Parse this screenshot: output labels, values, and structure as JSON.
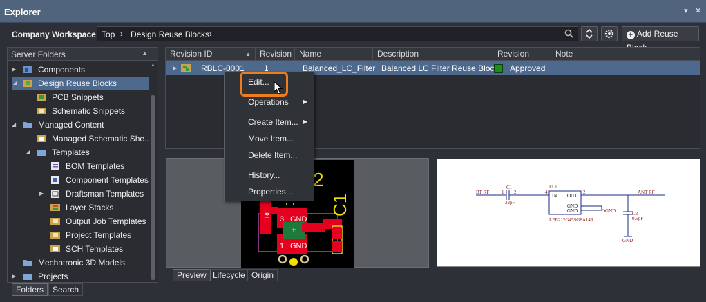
{
  "window": {
    "title": "Explorer",
    "pin_icon": "▾",
    "close_icon": "✕"
  },
  "toolbar": {
    "workspace": "Company Workspace",
    "breadcrumbs": [
      "Top",
      "Design Reuse Blocks"
    ],
    "add_button": "Add Reuse Block"
  },
  "left_panel": {
    "header": "Server Folders",
    "items": [
      {
        "label": "Components"
      },
      {
        "label": "Design Reuse Blocks"
      },
      {
        "label": "PCB Snippets"
      },
      {
        "label": "Schematic Snippets"
      },
      {
        "label": "Managed Content"
      },
      {
        "label": "Managed Schematic She..."
      },
      {
        "label": "Templates"
      },
      {
        "label": "BOM Templates"
      },
      {
        "label": "Component Templates"
      },
      {
        "label": "Draftsman Templates"
      },
      {
        "label": "Layer Stacks"
      },
      {
        "label": "Output Job Templates"
      },
      {
        "label": "Project Templates"
      },
      {
        "label": "SCH Templates"
      },
      {
        "label": "Mechatronic 3D Models"
      },
      {
        "label": "Projects"
      }
    ],
    "tabs": [
      "Folders",
      "Search"
    ]
  },
  "grid": {
    "columns": [
      "Revision ID",
      "Revision",
      "Name",
      "Description",
      "Revision State",
      "Note"
    ],
    "row": {
      "revision_id": "RBLC-0001",
      "revision": "1",
      "name": "Balanced_LC_Filter",
      "description": "Balanced LC Filter Reuse Block",
      "state": "Approved",
      "state_color": "#1e8c1e"
    }
  },
  "context_menu": {
    "items": [
      {
        "label": "Edit..."
      },
      {
        "label": "Operations"
      },
      {
        "label": "Create Item..."
      },
      {
        "label": "Move Item..."
      },
      {
        "label": "Delete Item..."
      },
      {
        "label": "History..."
      },
      {
        "label": "Properties..."
      }
    ]
  },
  "pcb_preview": {
    "labels": [
      "2",
      "C1",
      "RF",
      "3",
      "GND",
      "1",
      "GND"
    ]
  },
  "schematic_preview": {
    "labels": [
      "BT RF",
      "C1",
      "1",
      "2",
      "22pF",
      "FL1",
      "4",
      "IN",
      "OUT",
      "2",
      "GND",
      "GND",
      "LFB212G45SG8A143",
      "OGND",
      "ANT RF",
      "C2",
      "0.5pF",
      "GND"
    ]
  },
  "preview_tabs": [
    "Preview",
    "Lifecycle",
    "Origin"
  ],
  "colors": {
    "selection": "#4d6a8e",
    "highlight": "#ef7d1e",
    "titlebar": "#50647d"
  }
}
